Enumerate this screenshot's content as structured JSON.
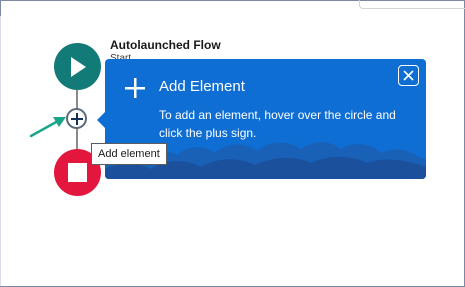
{
  "flow": {
    "title": "Autolaunched Flow",
    "subtitle": "Start"
  },
  "nodes": {
    "start_icon": "play-icon",
    "add_icon": "plus-icon",
    "end_icon": "stop-icon"
  },
  "tooltip": {
    "text": "Add element"
  },
  "popover": {
    "title": "Add Element",
    "body": "To add an element, hover over the circle and click the plus sign.",
    "close_icon": "close-icon",
    "title_icon": "plus-icon"
  },
  "colors": {
    "start": "#127b77",
    "end": "#e3173e",
    "popover": "#0e6ed4",
    "arrow": "#1aa58a"
  }
}
